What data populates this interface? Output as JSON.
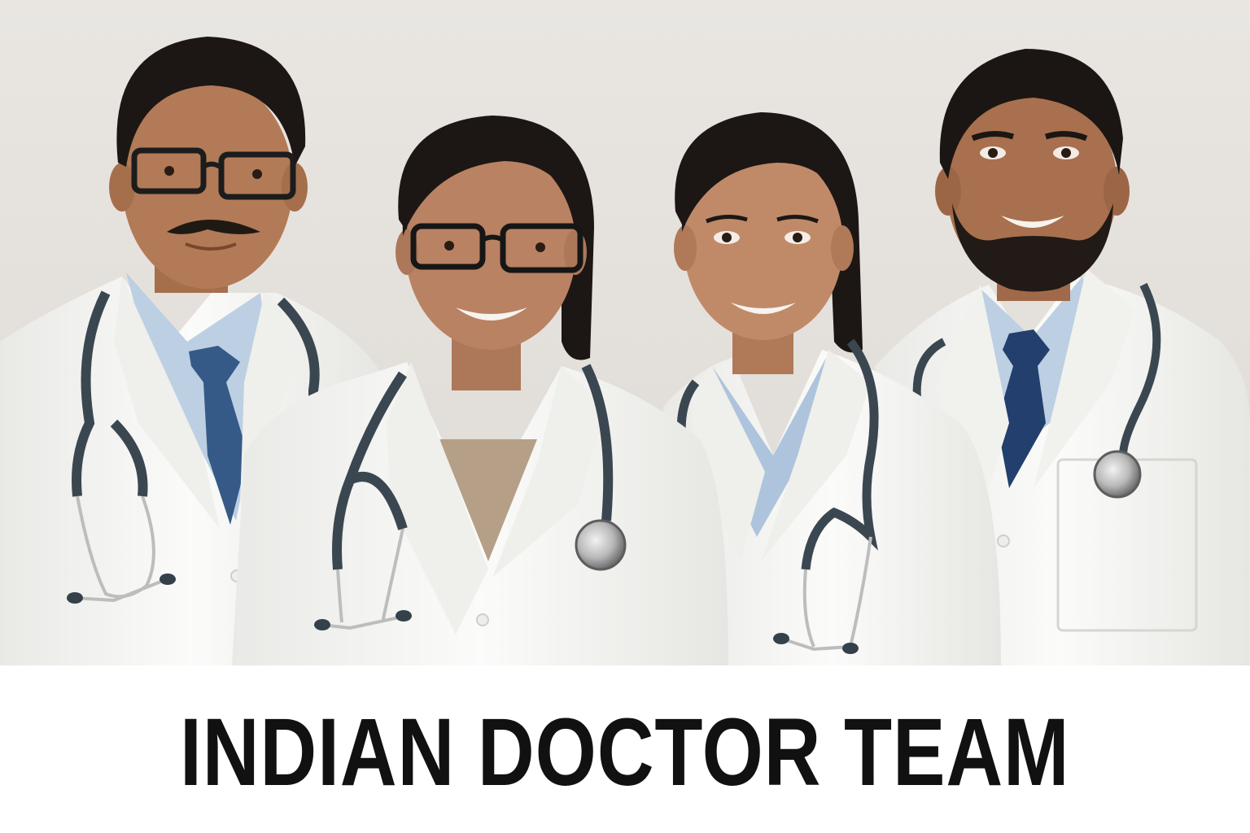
{
  "caption": {
    "title": "INDIAN DOCTOR TEAM"
  },
  "photo": {
    "subject": "four-doctors-group-photo",
    "colors": {
      "background": "#e4e1dc",
      "coat": "#f7f7f5",
      "coat_shadow": "#dcdcd8",
      "skin_1": "#b27a56",
      "skin_2": "#b98262",
      "skin_3": "#c08a69",
      "skin_4": "#a8704e",
      "hair": "#1c1714",
      "shirt": "#b9cde2",
      "tie": "#2c4a78",
      "tie_dark": "#1f3c6b",
      "stethoscope": "#3b4750",
      "metal": "#c8c8c8",
      "knit": "#b59f86",
      "caption_text": "#111111"
    }
  }
}
